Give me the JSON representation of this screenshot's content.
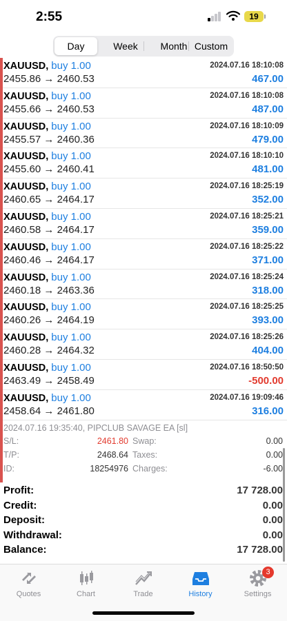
{
  "status": {
    "time": "2:55",
    "battery": "19"
  },
  "period_tabs": [
    {
      "label": "Day"
    },
    {
      "label": "Week"
    },
    {
      "label": "Month"
    },
    {
      "label": "Custom"
    }
  ],
  "deals": [
    {
      "symbol": "XAUUSD,",
      "direction": "buy 1.00",
      "time": "2024.07.16 18:10:08",
      "open": "2455.86",
      "close": "2460.53",
      "profit": "467.00"
    },
    {
      "symbol": "XAUUSD,",
      "direction": "buy 1.00",
      "time": "2024.07.16 18:10:08",
      "open": "2455.66",
      "close": "2460.53",
      "profit": "487.00"
    },
    {
      "symbol": "XAUUSD,",
      "direction": "buy 1.00",
      "time": "2024.07.16 18:10:09",
      "open": "2455.57",
      "close": "2460.36",
      "profit": "479.00"
    },
    {
      "symbol": "XAUUSD,",
      "direction": "buy 1.00",
      "time": "2024.07.16 18:10:10",
      "open": "2455.60",
      "close": "2460.41",
      "profit": "481.00"
    },
    {
      "symbol": "XAUUSD,",
      "direction": "buy 1.00",
      "time": "2024.07.16 18:25:19",
      "open": "2460.65",
      "close": "2464.17",
      "profit": "352.00"
    },
    {
      "symbol": "XAUUSD,",
      "direction": "buy 1.00",
      "time": "2024.07.16 18:25:21",
      "open": "2460.58",
      "close": "2464.17",
      "profit": "359.00"
    },
    {
      "symbol": "XAUUSD,",
      "direction": "buy 1.00",
      "time": "2024.07.16 18:25:22",
      "open": "2460.46",
      "close": "2464.17",
      "profit": "371.00"
    },
    {
      "symbol": "XAUUSD,",
      "direction": "buy 1.00",
      "time": "2024.07.16 18:25:24",
      "open": "2460.18",
      "close": "2463.36",
      "profit": "318.00"
    },
    {
      "symbol": "XAUUSD,",
      "direction": "buy 1.00",
      "time": "2024.07.16 18:25:25",
      "open": "2460.26",
      "close": "2464.19",
      "profit": "393.00"
    },
    {
      "symbol": "XAUUSD,",
      "direction": "buy 1.00",
      "time": "2024.07.16 18:25:26",
      "open": "2460.28",
      "close": "2464.32",
      "profit": "404.00"
    },
    {
      "symbol": "XAUUSD,",
      "direction": "buy 1.00",
      "time": "2024.07.16 18:50:50",
      "open": "2463.49",
      "close": "2458.49",
      "profit": "-500.00"
    },
    {
      "symbol": "XAUUSD,",
      "direction": "buy 1.00",
      "time": "2024.07.16 19:09:46",
      "open": "2458.64",
      "close": "2461.80",
      "profit": "316.00"
    }
  ],
  "arrow": "→",
  "details": {
    "header": "2024.07.16 19:35:40, PIPCLUB SAVAGE EA [sl]",
    "sl_label": "S/L:",
    "sl_value": "2461.80",
    "tp_label": "T/P:",
    "tp_value": "2468.64",
    "id_label": "ID:",
    "id_value": "18254976",
    "swap_label": "Swap:",
    "swap_value": "0.00",
    "taxes_label": "Taxes:",
    "taxes_value": "0.00",
    "charges_label": "Charges:",
    "charges_value": "-6.00"
  },
  "summary": [
    {
      "label": "Profit:",
      "value": "17 728.00"
    },
    {
      "label": "Credit:",
      "value": "0.00"
    },
    {
      "label": "Deposit:",
      "value": "0.00"
    },
    {
      "label": "Withdrawal:",
      "value": "0.00"
    },
    {
      "label": "Balance:",
      "value": "17 728.00"
    }
  ],
  "tabbar": [
    {
      "label": "Quotes",
      "icon": "quotes-icon"
    },
    {
      "label": "Chart",
      "icon": "candlestick-icon"
    },
    {
      "label": "Trade",
      "icon": "trade-icon"
    },
    {
      "label": "History",
      "icon": "inbox-icon"
    },
    {
      "label": "Settings",
      "icon": "gear-icon",
      "badge": "3"
    }
  ],
  "colors": {
    "accent": "#1e7fe0",
    "negative": "#e23b2f",
    "side_marker": "#d9534f"
  }
}
